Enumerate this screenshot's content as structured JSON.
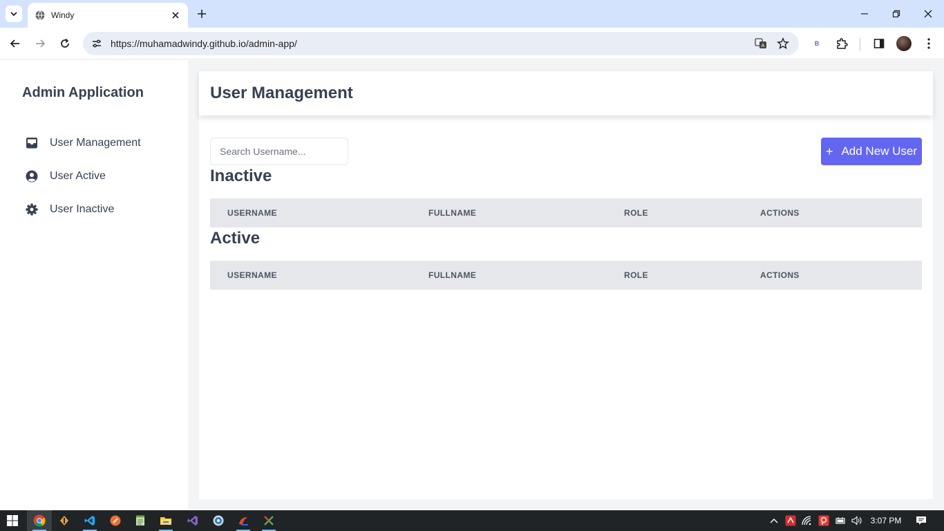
{
  "browser": {
    "tab_title": "Windy",
    "url": "https://muhamadwindy.github.io/admin-app/",
    "extension_letter": "B"
  },
  "sidebar": {
    "app_title": "Admin Application",
    "items": [
      {
        "label": "User Management",
        "icon": "inbox-icon"
      },
      {
        "label": "User Active",
        "icon": "user-circle-icon"
      },
      {
        "label": "User Inactive",
        "icon": "gear-icon"
      }
    ]
  },
  "main": {
    "page_title": "User Management",
    "search_placeholder": "Search Username...",
    "add_button_label": "Add New User",
    "sections": [
      {
        "title": "Inactive",
        "columns": [
          "USERNAME",
          "FULLNAME",
          "ROLE",
          "ACTIONS"
        ]
      },
      {
        "title": "Active",
        "columns": [
          "USERNAME",
          "FULLNAME",
          "ROLE",
          "ACTIONS"
        ]
      }
    ]
  },
  "taskbar": {
    "time": "3:07 PM"
  },
  "colors": {
    "accent": "#6366f1",
    "tab_strip": "#d3e3fd",
    "table_header": "#e5e7eb",
    "page_bg": "#f3f4f6"
  }
}
